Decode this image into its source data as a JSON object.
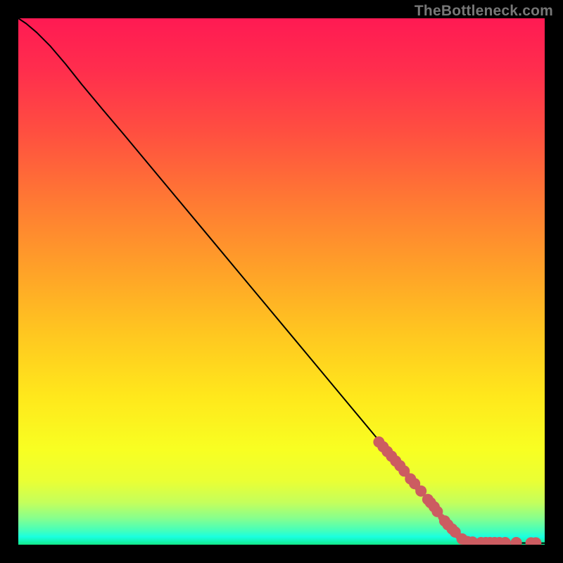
{
  "watermark": "TheBottleneck.com",
  "chart_data": {
    "type": "line",
    "title": "",
    "xlabel": "",
    "ylabel": "",
    "xlim": [
      0,
      100
    ],
    "ylim": [
      0,
      100
    ],
    "grid": false,
    "legend": false,
    "series": [
      {
        "name": "curve",
        "points": [
          {
            "x": 0.0,
            "y": 100.0
          },
          {
            "x": 1.5,
            "y": 99.0
          },
          {
            "x": 3.5,
            "y": 97.3
          },
          {
            "x": 6.0,
            "y": 94.8
          },
          {
            "x": 9.0,
            "y": 91.3
          },
          {
            "x": 12.0,
            "y": 87.5
          },
          {
            "x": 16.0,
            "y": 82.7
          },
          {
            "x": 20.0,
            "y": 78.0
          },
          {
            "x": 28.0,
            "y": 68.4
          },
          {
            "x": 36.0,
            "y": 58.8
          },
          {
            "x": 44.0,
            "y": 49.2
          },
          {
            "x": 52.0,
            "y": 39.6
          },
          {
            "x": 60.0,
            "y": 30.0
          },
          {
            "x": 68.0,
            "y": 20.4
          },
          {
            "x": 76.0,
            "y": 10.8
          },
          {
            "x": 82.0,
            "y": 3.6
          },
          {
            "x": 84.8,
            "y": 0.8
          },
          {
            "x": 86.0,
            "y": 0.4
          },
          {
            "x": 100.0,
            "y": 0.3
          }
        ]
      }
    ],
    "highlight_points": {
      "name": "dots",
      "color": "#cc5c61",
      "radius_major": 8,
      "radius_minor": 5,
      "points": [
        {
          "x": 68.5,
          "y": 19.5,
          "r": 8
        },
        {
          "x": 69.3,
          "y": 18.6,
          "r": 8
        },
        {
          "x": 70.1,
          "y": 17.7,
          "r": 8
        },
        {
          "x": 70.9,
          "y": 16.8,
          "r": 8
        },
        {
          "x": 71.7,
          "y": 15.9,
          "r": 8
        },
        {
          "x": 72.5,
          "y": 15.0,
          "r": 8
        },
        {
          "x": 73.3,
          "y": 14.0,
          "r": 8
        },
        {
          "x": 73.7,
          "y": 13.5,
          "r": 5
        },
        {
          "x": 74.5,
          "y": 12.5,
          "r": 8
        },
        {
          "x": 75.3,
          "y": 11.6,
          "r": 8
        },
        {
          "x": 76.0,
          "y": 10.7,
          "r": 5
        },
        {
          "x": 76.5,
          "y": 10.2,
          "r": 8
        },
        {
          "x": 77.8,
          "y": 8.6,
          "r": 8
        },
        {
          "x": 78.3,
          "y": 8.0,
          "r": 8
        },
        {
          "x": 79.0,
          "y": 7.2,
          "r": 8
        },
        {
          "x": 79.6,
          "y": 6.3,
          "r": 8
        },
        {
          "x": 80.4,
          "y": 5.2,
          "r": 5
        },
        {
          "x": 81.0,
          "y": 4.5,
          "r": 8
        },
        {
          "x": 81.6,
          "y": 3.8,
          "r": 8
        },
        {
          "x": 82.4,
          "y": 3.0,
          "r": 8
        },
        {
          "x": 83.0,
          "y": 2.4,
          "r": 8
        },
        {
          "x": 83.6,
          "y": 1.7,
          "r": 5
        },
        {
          "x": 84.3,
          "y": 1.1,
          "r": 8
        },
        {
          "x": 85.3,
          "y": 0.6,
          "r": 8
        },
        {
          "x": 86.3,
          "y": 0.5,
          "r": 8
        },
        {
          "x": 87.1,
          "y": 0.4,
          "r": 5
        },
        {
          "x": 87.9,
          "y": 0.4,
          "r": 8
        },
        {
          "x": 88.8,
          "y": 0.4,
          "r": 8
        },
        {
          "x": 89.6,
          "y": 0.4,
          "r": 8
        },
        {
          "x": 90.5,
          "y": 0.4,
          "r": 8
        },
        {
          "x": 91.4,
          "y": 0.4,
          "r": 8
        },
        {
          "x": 92.5,
          "y": 0.4,
          "r": 8
        },
        {
          "x": 94.6,
          "y": 0.4,
          "r": 8
        },
        {
          "x": 97.4,
          "y": 0.35,
          "r": 8
        },
        {
          "x": 98.3,
          "y": 0.35,
          "r": 8
        }
      ]
    }
  }
}
